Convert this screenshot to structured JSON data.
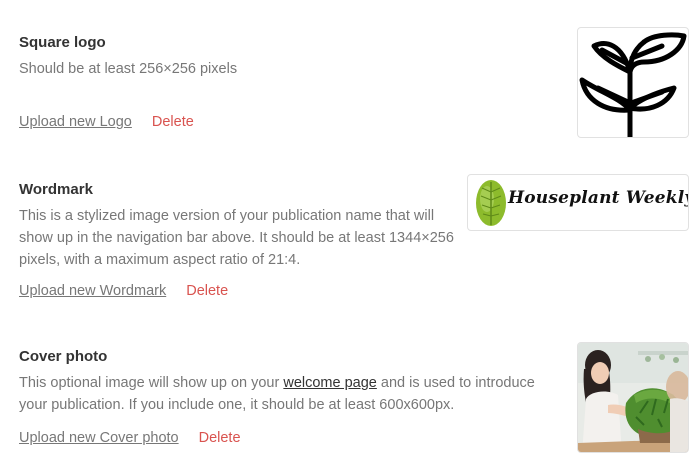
{
  "square_logo": {
    "title": "Square logo",
    "description": "Should be at least 256×256 pixels",
    "upload_label": "Upload new Logo",
    "delete_label": "Delete"
  },
  "wordmark": {
    "title": "Wordmark",
    "description": "This is a stylized image version of your publication name that will show up in the navigation bar above. It should be at least 1344×256 pixels, with a maximum aspect ratio of 21:4.",
    "upload_label": "Upload new Wordmark",
    "delete_label": "Delete",
    "preview_text": "Houseplant Weekly"
  },
  "cover_photo": {
    "title": "Cover photo",
    "description_before": "This optional image will show up on your ",
    "description_link": "welcome page",
    "description_after": " and is used to introduce your publication. If you include one, it should be at least 600x600px.",
    "upload_label": "Upload new Cover photo",
    "delete_label": "Delete"
  },
  "colors": {
    "delete": "#d9534f",
    "muted_text": "#777777",
    "title_text": "#333333",
    "leaf_green": "#8dbb2c"
  },
  "icons": {
    "logo_preview": "plant-sprout-logo",
    "wordmark_preview": "leaf-icon",
    "cover_preview": "woman-with-plant-photo"
  }
}
